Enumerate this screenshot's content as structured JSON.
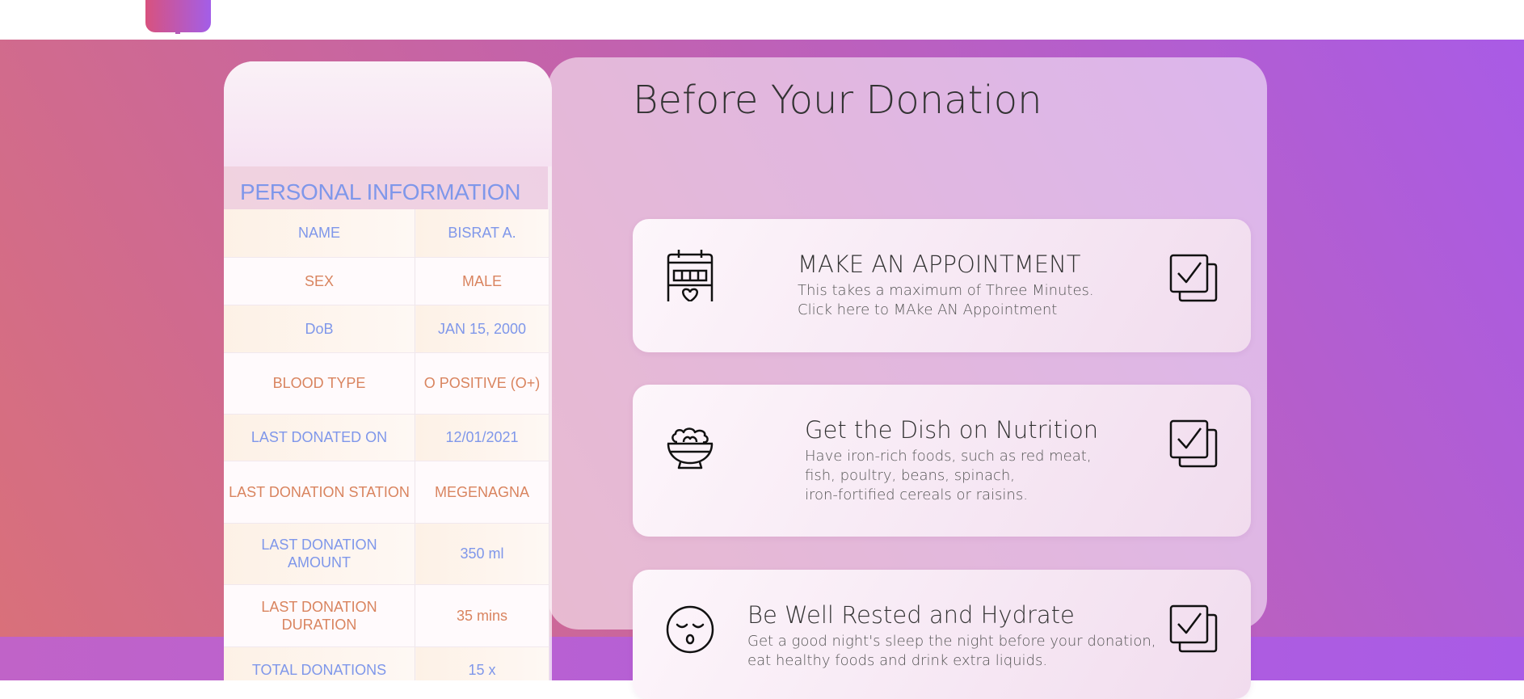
{
  "main": {
    "title": "Before Your Donation",
    "cards": [
      {
        "title": "MAKE AN APPOINTMENT",
        "desc": [
          "This takes a maximum of Three Minutes.",
          "Click here to MAke AN Appointment"
        ],
        "icon": "calendar-heart-icon",
        "check_icon": "checkbox-stack-icon"
      },
      {
        "title": "Get the Dish on Nutrition",
        "desc": [
          "Have iron-rich foods, such as red meat,",
          "fish, poultry, beans, spinach,",
          "iron-fortified cereals or raisins."
        ],
        "icon": "salad-bowl-icon",
        "check_icon": "checkbox-stack-icon"
      },
      {
        "title": "Be Well Rested and Hydrate",
        "desc": [
          "Get a good night's sleep the night before your donation,",
          "eat healthy foods and drink extra liquids."
        ],
        "icon": "sleepy-face-icon",
        "check_icon": "checkbox-stack-icon"
      }
    ]
  },
  "personal_info": {
    "heading": "PERSONAL INFORMATION",
    "rows": [
      {
        "label": "NAME",
        "value": "BISRAT A."
      },
      {
        "label": "SEX",
        "value": "MALE"
      },
      {
        "label": "DoB",
        "value": "JAN 15, 2000"
      },
      {
        "label": "BLOOD TYPE",
        "value": "O POSITIVE (O+)"
      },
      {
        "label": "LAST DONATED ON",
        "value": "12/01/2021"
      },
      {
        "label": "LAST DONATION STATION",
        "value": "MEGENAGNA"
      },
      {
        "label": "LAST DONATION AMOUNT",
        "value": "350 ml"
      },
      {
        "label": "LAST DONATION DURATION",
        "value": "35 mins"
      },
      {
        "label": "TOTAL DONATIONS",
        "value": "15 x"
      }
    ]
  },
  "colors": {
    "accent_blue": "#7f97ea",
    "accent_orange": "#d9845f",
    "gradient_start": "#d9707a",
    "gradient_end": "#a95be6"
  }
}
